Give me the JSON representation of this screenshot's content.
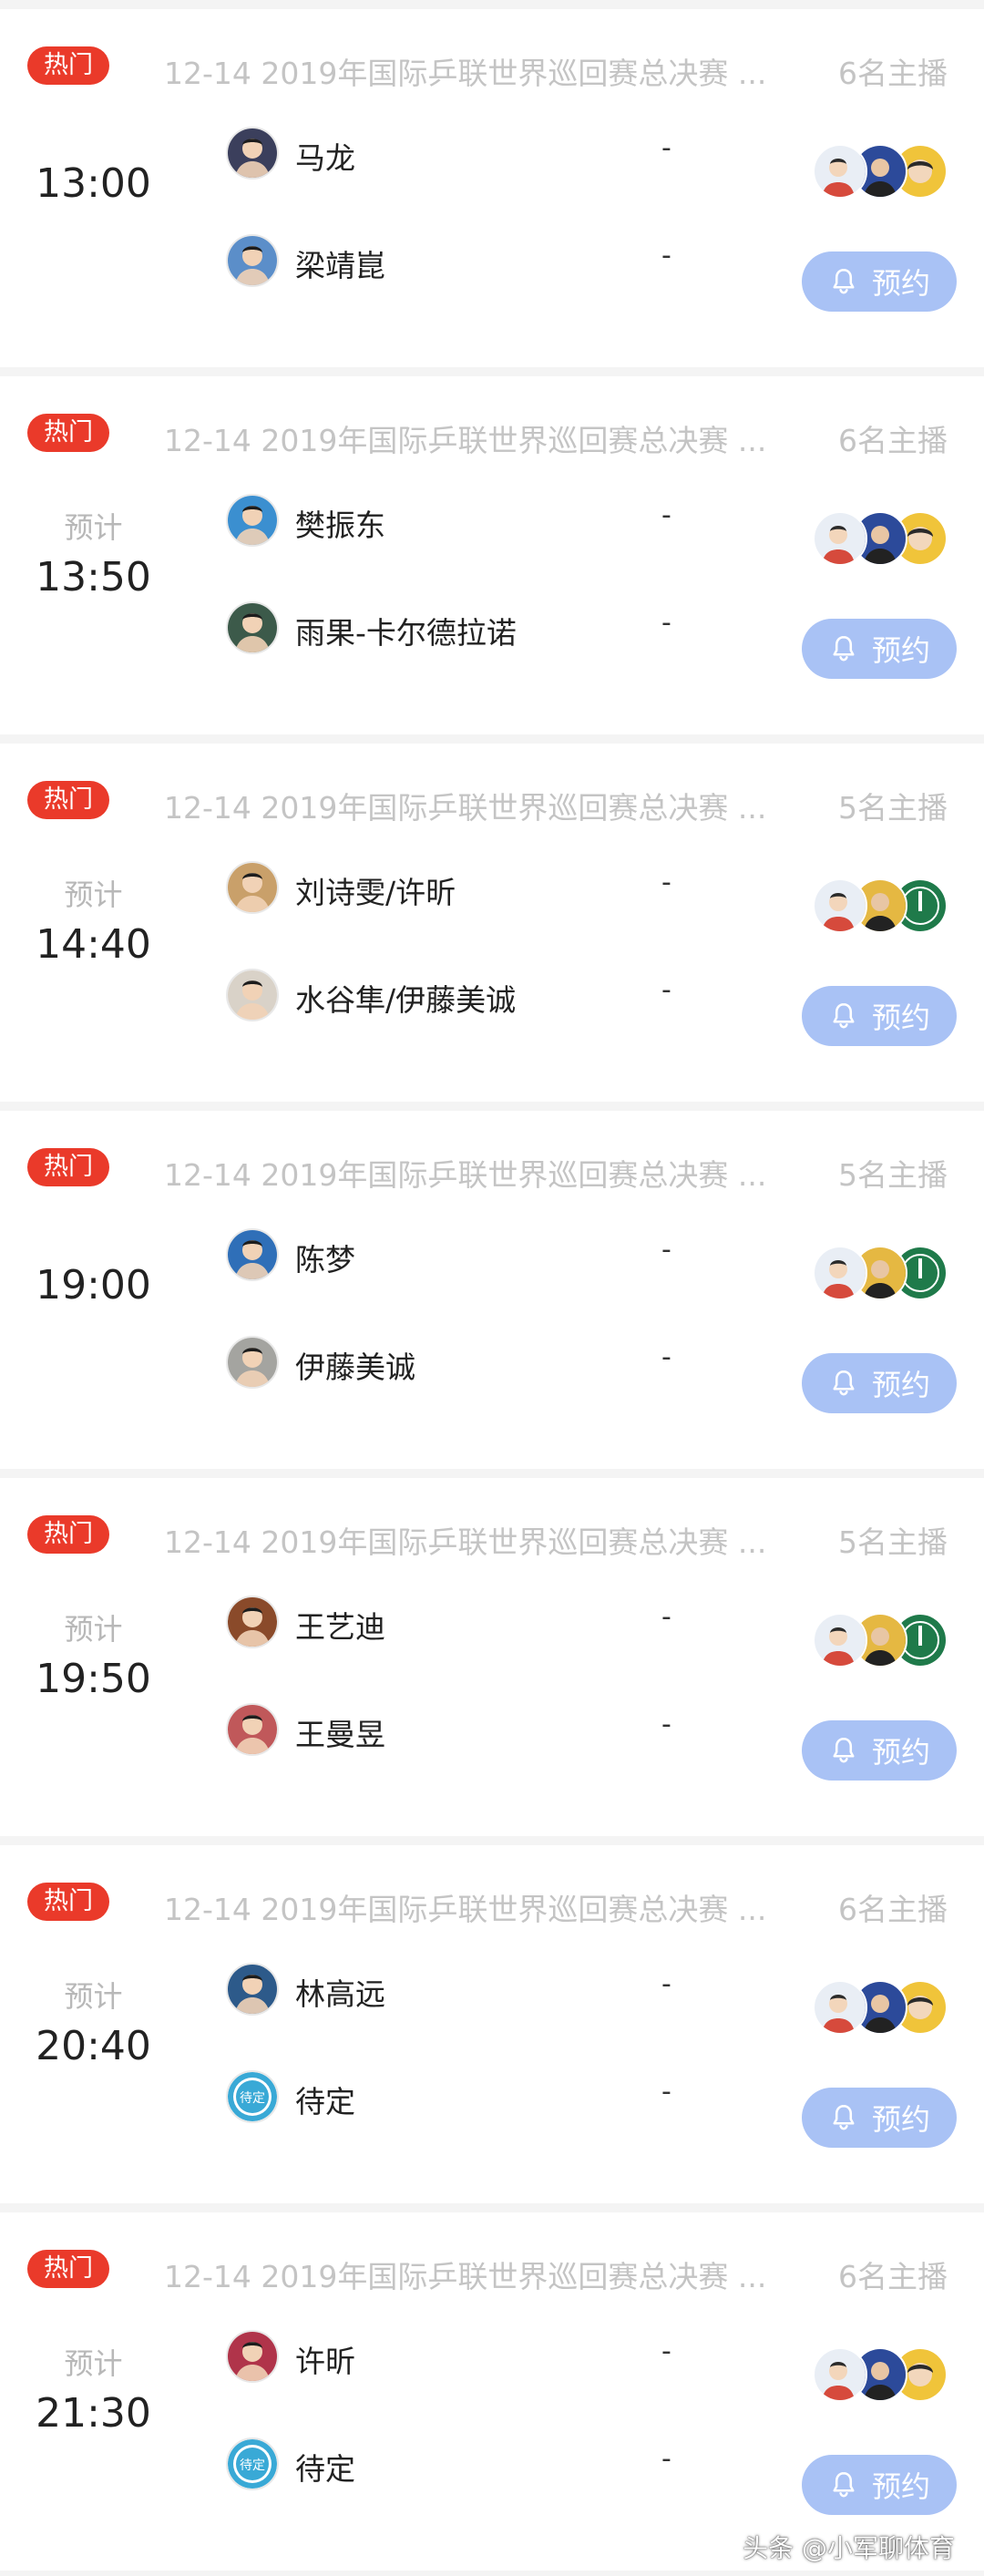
{
  "colors": {
    "hot_badge": "#ea3a2a",
    "reserve_button": "#a9c2f5",
    "muted_text": "#c4c4c4",
    "primary_text": "#222222"
  },
  "icons": {
    "reserve": "bell-icon",
    "player": "player-avatar",
    "host": "host-avatar"
  },
  "matches": [
    {
      "badge": "热门",
      "event": "12-14 2019年国际乒联世界巡回赛总决赛 ...",
      "hosts": "6名主播",
      "time_label": "",
      "time": "13:00",
      "players": [
        {
          "name": "马龙",
          "score": "-",
          "avatar_color": "#3b3f5c"
        },
        {
          "name": "梁靖崑",
          "score": "-",
          "avatar_color": "#5b8ec9"
        }
      ],
      "host_avatar_set": "blue",
      "reserve": "预约"
    },
    {
      "badge": "热门",
      "event": "12-14 2019年国际乒联世界巡回赛总决赛 ...",
      "hosts": "6名主播",
      "time_label": "预计",
      "time": "13:50",
      "players": [
        {
          "name": "樊振东",
          "score": "-",
          "avatar_color": "#3b8fd0"
        },
        {
          "name": "雨果-卡尔德拉诺",
          "score": "-",
          "avatar_color": "#3c5a4a"
        }
      ],
      "host_avatar_set": "blue",
      "reserve": "预约"
    },
    {
      "badge": "热门",
      "event": "12-14 2019年国际乒联世界巡回赛总决赛 ...",
      "hosts": "5名主播",
      "time_label": "预计",
      "time": "14:40",
      "players": [
        {
          "name": "刘诗雯/许昕",
          "score": "-",
          "avatar_color": "#c9a06a"
        },
        {
          "name": "水谷隼/伊藤美诚",
          "score": "-",
          "avatar_color": "#d9d2c8"
        }
      ],
      "host_avatar_set": "green",
      "reserve": "预约"
    },
    {
      "badge": "热门",
      "event": "12-14 2019年国际乒联世界巡回赛总决赛 ...",
      "hosts": "5名主播",
      "time_label": "",
      "time": "19:00",
      "players": [
        {
          "name": "陈梦",
          "score": "-",
          "avatar_color": "#2f6fb8"
        },
        {
          "name": "伊藤美诚",
          "score": "-",
          "avatar_color": "#a4a4a0"
        }
      ],
      "host_avatar_set": "green",
      "reserve": "预约"
    },
    {
      "badge": "热门",
      "event": "12-14 2019年国际乒联世界巡回赛总决赛 ...",
      "hosts": "5名主播",
      "time_label": "预计",
      "time": "19:50",
      "players": [
        {
          "name": "王艺迪",
          "score": "-",
          "avatar_color": "#8a4a2a"
        },
        {
          "name": "王曼昱",
          "score": "-",
          "avatar_color": "#c0585a"
        }
      ],
      "host_avatar_set": "green",
      "reserve": "预约"
    },
    {
      "badge": "热门",
      "event": "12-14 2019年国际乒联世界巡回赛总决赛 ...",
      "hosts": "6名主播",
      "time_label": "预计",
      "time": "20:40",
      "players": [
        {
          "name": "林高远",
          "score": "-",
          "avatar_color": "#2d5a8a"
        },
        {
          "name": "待定",
          "score": "-",
          "avatar_color": "#39a9d6",
          "tbd": true
        }
      ],
      "host_avatar_set": "blue",
      "reserve": "预约"
    },
    {
      "badge": "热门",
      "event": "12-14 2019年国际乒联世界巡回赛总决赛 ...",
      "hosts": "6名主播",
      "time_label": "预计",
      "time": "21:30",
      "players": [
        {
          "name": "许昕",
          "score": "-",
          "avatar_color": "#b0344a"
        },
        {
          "name": "待定",
          "score": "-",
          "avatar_color": "#39a9d6",
          "tbd": true
        }
      ],
      "host_avatar_set": "blue",
      "reserve": "预约"
    }
  ],
  "tbd_avatar_text": "待定",
  "watermark": "头条 @小军聊体育"
}
